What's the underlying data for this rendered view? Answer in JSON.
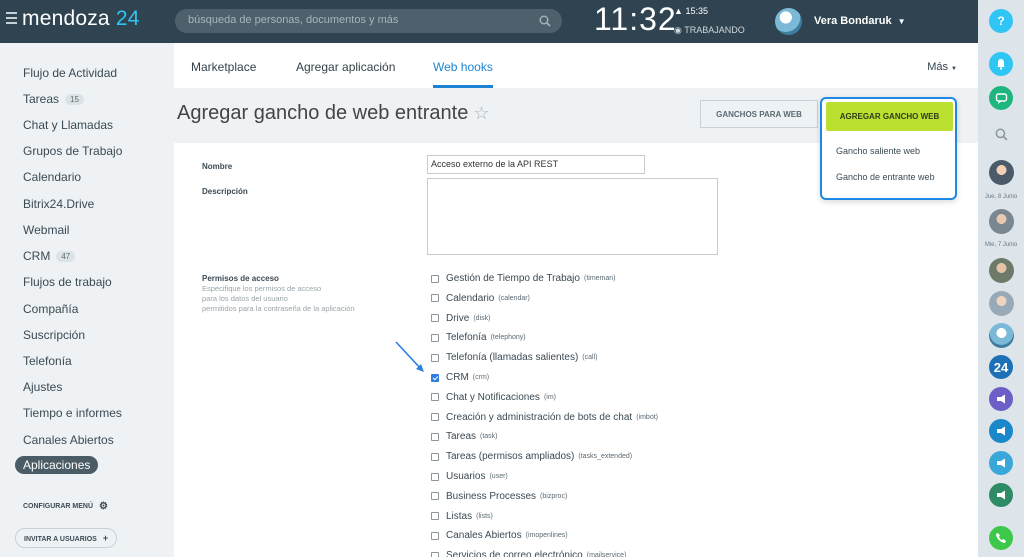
{
  "header": {
    "logo_main": "mendoza",
    "logo_num": "24",
    "search_placeholder": "búsqueda de personas, documentos y más",
    "clock": "11:32",
    "status_time": "15:35",
    "status_label": "TRABAJANDO",
    "user_name": "Vera Bondaruk",
    "help_label": "?"
  },
  "sidebar": {
    "items": [
      {
        "label": "Flujo de Actividad"
      },
      {
        "label": "Tareas",
        "count": "15"
      },
      {
        "label": "Chat y Llamadas"
      },
      {
        "label": "Grupos de Trabajo"
      },
      {
        "label": "Calendario"
      },
      {
        "label": "Bitrix24.Drive"
      },
      {
        "label": "Webmail"
      },
      {
        "label": "CRM",
        "count": "47"
      },
      {
        "label": "Flujos de trabajo"
      },
      {
        "label": "Compañía"
      },
      {
        "label": "Suscripción"
      },
      {
        "label": "Telefonía"
      },
      {
        "label": "Ajustes"
      },
      {
        "label": "Tiempo e informes"
      },
      {
        "label": "Canales Abiertos"
      },
      {
        "label": "Aplicaciones",
        "active": true
      }
    ],
    "config_label": "CONFIGURAR MENÚ",
    "invite_label": "INVITAR A USUARIOS"
  },
  "tabs": {
    "items": [
      "Marketplace",
      "Agregar aplicación",
      "Web hooks"
    ],
    "more": "Más"
  },
  "page": {
    "title": "Agregar gancho de web entrante",
    "hooks_button": "GANCHOS PARA WEB",
    "add_button": "AGREGAR GANCHO WEB",
    "menu_options": [
      "Gancho saliente web",
      "Gancho de entrante web"
    ]
  },
  "form": {
    "name_label": "Nombre",
    "name_value": "Acceso externo de la API REST",
    "desc_label": "Descripción",
    "perm_label": "Permisos de acceso",
    "perm_hint": [
      "Especifique los permisos de acceso",
      "para los datos del usuario",
      "permitidos para la contraseña de la aplicación"
    ],
    "permissions": [
      {
        "label": "Gestión de Tiempo de Trabajo",
        "code": "(timeman)",
        "checked": false
      },
      {
        "label": "Calendario",
        "code": "(calendar)",
        "checked": false
      },
      {
        "label": "Drive",
        "code": "(disk)",
        "checked": false
      },
      {
        "label": "Telefonía",
        "code": "(telephony)",
        "checked": false
      },
      {
        "label": "Telefonía (llamadas salientes)",
        "code": "(call)",
        "checked": false
      },
      {
        "label": "CRM",
        "code": "(crm)",
        "checked": true
      },
      {
        "label": "Chat y Notificaciones",
        "code": "(im)",
        "checked": false
      },
      {
        "label": "Creación y administración de bots de chat",
        "code": "(imbot)",
        "checked": false
      },
      {
        "label": "Tareas",
        "code": "(task)",
        "checked": false
      },
      {
        "label": "Tareas (permisos ampliados)",
        "code": "(tasks_extended)",
        "checked": false
      },
      {
        "label": "Usuarios",
        "code": "(user)",
        "checked": false
      },
      {
        "label": "Business Processes",
        "code": "(bizproc)",
        "checked": false
      },
      {
        "label": "Listas",
        "code": "(lists)",
        "checked": false
      },
      {
        "label": "Canales Abiertos",
        "code": "(imopenlines)",
        "checked": false
      },
      {
        "label": "Servicios de correo electrónico",
        "code": "(mailservice)",
        "checked": false
      }
    ]
  },
  "rail": {
    "dates": [
      "Jue, 8 Junio",
      "Mie, 7 Junio"
    ],
    "badge_24": "24"
  },
  "colors": {
    "topbar": "#2f4450",
    "accent": "#1a84d3",
    "add_button": "#bbe030",
    "rail_teal": "#2fc6f6",
    "rail_green": "#3ec84a"
  }
}
